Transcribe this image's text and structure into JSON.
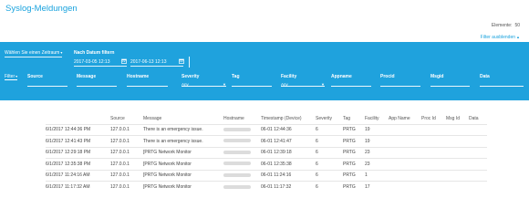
{
  "page": {
    "title": "Syslog-Meldungen"
  },
  "counts": {
    "label": "Elemente:",
    "value": "50"
  },
  "filter_toggle": {
    "label": "Filter ausblenden"
  },
  "filter": {
    "time_select": "Wählen Sie einen Zeitraum",
    "date_label": "Nach Datum filtern",
    "date_from": "2017-03-05 12:13",
    "date_to": "2017-06-13 12:13",
    "filter_link": "Filter",
    "columns": [
      {
        "label": "Source",
        "value": ""
      },
      {
        "label": "Message",
        "value": ""
      },
      {
        "label": "Hostname",
        "value": ""
      },
      {
        "label": "Severity",
        "value": "Any"
      },
      {
        "label": "Tag",
        "value": ""
      },
      {
        "label": "Facility",
        "value": "Any"
      },
      {
        "label": "Appname",
        "value": ""
      },
      {
        "label": "Procid",
        "value": ""
      },
      {
        "label": "Msgid",
        "value": ""
      },
      {
        "label": "Data",
        "value": ""
      }
    ]
  },
  "table": {
    "headers": [
      "",
      "Source",
      "Message",
      "Hostname",
      "Timestamp (Device)",
      "Severity",
      "Tag",
      "Facility",
      "App Name",
      "Proc Id",
      "Msg Id",
      "Data"
    ],
    "rows": [
      {
        "date": "6/1/2017 12:44:36 PM",
        "source": "127.0.0.1",
        "message": "There is an emergency issue.",
        "timestamp": "06-01 12:44:36",
        "severity": "6",
        "tag": "PRTG",
        "facility": "19"
      },
      {
        "date": "6/1/2017 12:41:43 PM",
        "source": "127.0.0.1",
        "message": "There is an emergency issue.",
        "timestamp": "06-01 12:41:47",
        "severity": "6",
        "tag": "PRTG",
        "facility": "19"
      },
      {
        "date": "6/1/2017 12:29:18 PM",
        "source": "127.0.0.1",
        "message": "[PRTG Network Monitor",
        "timestamp": "06-01 12:39:18",
        "severity": "6",
        "tag": "PRTG",
        "facility": "23"
      },
      {
        "date": "6/1/2017 12:35:38 PM",
        "source": "127.0.0.1",
        "message": "[PRTG Network Monitor",
        "timestamp": "06-01 12:35:38",
        "severity": "6",
        "tag": "PRTG",
        "facility": "23"
      },
      {
        "date": "6/1/2017 11:24:16 AM",
        "source": "127.0.0.1",
        "message": "[PRTG Network Monitor",
        "timestamp": "06-01 11:24:16",
        "severity": "6",
        "tag": "PRTG",
        "facility": "1"
      },
      {
        "date": "6/1/2017 11:17:32 AM",
        "source": "127.0.0.1",
        "message": "[PRTG Network Monitor",
        "timestamp": "06-01 11:17:32",
        "severity": "6",
        "tag": "PRTG",
        "facility": "17"
      }
    ]
  },
  "icons": {
    "calendar": "calendar-icon",
    "chevron": "chevron-down-icon",
    "caret": "caret-down-icon"
  },
  "colors": {
    "accent": "#1fa2dd",
    "title": "#1aa3de"
  }
}
